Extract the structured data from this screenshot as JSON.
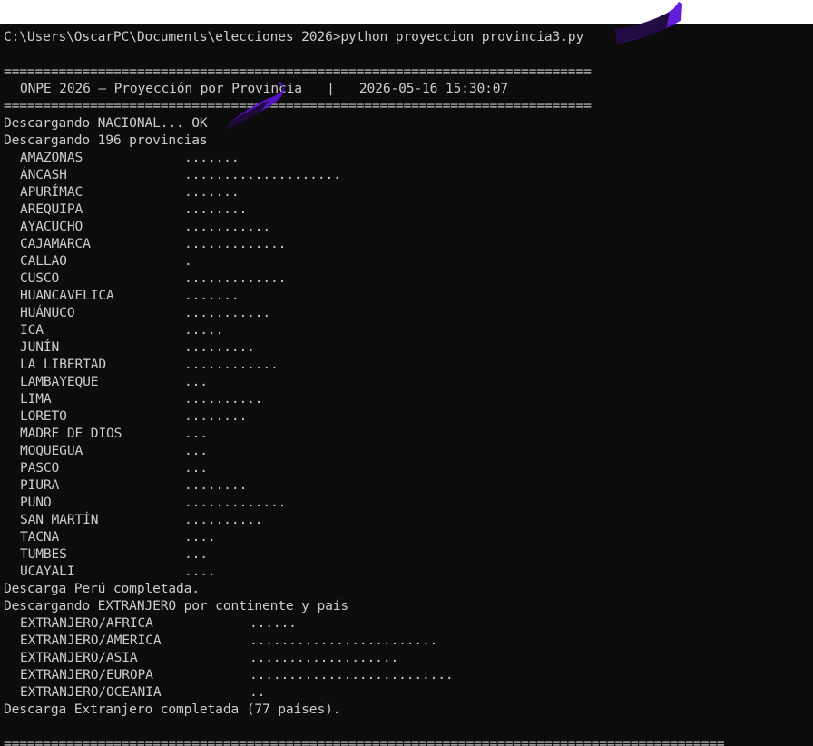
{
  "command": "C:\\Users\\OscarPC\\Documents\\elecciones_2026>python proyeccion_provincia3.py",
  "separator": "===========================================================================",
  "header": {
    "title": "ONPE 2026 – Proyección por Provincia",
    "divider": "|",
    "timestamp": "2026-05-16 15:30:07"
  },
  "status": {
    "nacional": "Descargando NACIONAL... OK",
    "provincias": "Descargando 196 provincias",
    "peru_done": "Descarga Perú completada.",
    "extranjero_start": "Descargando EXTRANJERO por continente y país",
    "extranjero_done": "Descarga Extranjero completada (77 países)."
  },
  "regions": [
    {
      "name": "AMAZONAS",
      "dots": "......."
    },
    {
      "name": "ÁNCASH",
      "dots": "...................."
    },
    {
      "name": "APURÍMAC",
      "dots": "......."
    },
    {
      "name": "AREQUIPA",
      "dots": "........"
    },
    {
      "name": "AYACUCHO",
      "dots": "..........."
    },
    {
      "name": "CAJAMARCA",
      "dots": "............."
    },
    {
      "name": "CALLAO",
      "dots": "."
    },
    {
      "name": "CUSCO",
      "dots": "............."
    },
    {
      "name": "HUANCAVELICA",
      "dots": "......."
    },
    {
      "name": "HUÁNUCO",
      "dots": "..........."
    },
    {
      "name": "ICA",
      "dots": "....."
    },
    {
      "name": "JUNÍN",
      "dots": "........."
    },
    {
      "name": "LA LIBERTAD",
      "dots": "............"
    },
    {
      "name": "LAMBAYEQUE",
      "dots": "..."
    },
    {
      "name": "LIMA",
      "dots": ".........."
    },
    {
      "name": "LORETO",
      "dots": "........"
    },
    {
      "name": "MADRE DE DIOS",
      "dots": "..."
    },
    {
      "name": "MOQUEGUA",
      "dots": "..."
    },
    {
      "name": "PASCO",
      "dots": "..."
    },
    {
      "name": "PIURA",
      "dots": "........"
    },
    {
      "name": "PUNO",
      "dots": "............."
    },
    {
      "name": "SAN MARTÍN",
      "dots": ".........."
    },
    {
      "name": "TACNA",
      "dots": "...."
    },
    {
      "name": "TUMBES",
      "dots": "..."
    },
    {
      "name": "UCAYALI",
      "dots": "...."
    }
  ],
  "continents": [
    {
      "name": "EXTRANJERO/AFRICA",
      "dots": "......"
    },
    {
      "name": "EXTRANJERO/AMERICA",
      "dots": "........................"
    },
    {
      "name": "EXTRANJERO/ASIA",
      "dots": "..................."
    },
    {
      "name": "EXTRANJERO/EUROPA",
      "dots": ".........................."
    },
    {
      "name": "EXTRANJERO/OCEANIA",
      "dots": ".."
    }
  ],
  "final_separator": "============================================================================================",
  "colors": {
    "terminal_bg": "#0c0c0c",
    "terminal_fg": "#cccccc",
    "marker": "#5a14d8"
  }
}
